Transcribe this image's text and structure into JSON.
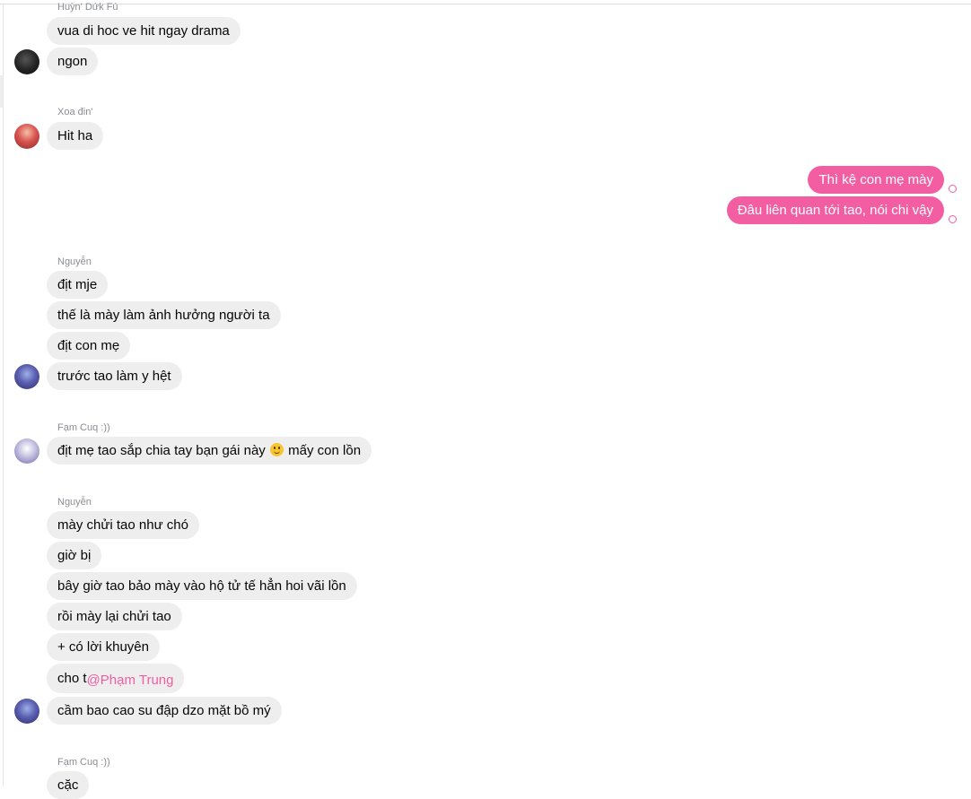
{
  "groups": [
    {
      "sender": "Huỳn' Dứk Fú",
      "messages": [
        "vua di hoc ve hit ngay drama",
        "ngon"
      ]
    },
    {
      "sender": "Xoa đin'",
      "messages": [
        "Hit ha"
      ]
    },
    {
      "sender": "",
      "messages": [
        "Thì kệ con mẹ mày",
        "Đâu liên quan tới tao, nói chi vậy"
      ]
    },
    {
      "sender": "Nguyễn",
      "messages": [
        "địt mje",
        "thế là mày làm ảnh hưởng người ta",
        "địt con mẹ",
        "trước tao làm y hệt"
      ]
    },
    {
      "sender": "Fạm Cuq :))",
      "messages": [
        "địt mẹ tao sắp chia tay bạn gái này",
        "mấy con lồn"
      ]
    },
    {
      "sender": "Nguyễn",
      "messages": [
        "mày chửi tao như chó",
        "giờ bị",
        "bây giờ tao bảo mày vào hộ tử tế hẳn hoi vãi lồn",
        "rồi mày lại chửi tao",
        "+ có lời khuyên",
        "cho t",
        "cầm bao cao su đập dzo mặt bồ mý"
      ],
      "mention": "@Phạm Trung"
    },
    {
      "sender": "Fạm Cuq :))",
      "messages": [
        "cặc"
      ]
    }
  ],
  "icons": {
    "emoji": "slightly-smiling-face-icon",
    "seen": "seen-check-icon"
  },
  "colors": {
    "outgoing_bubble": "#f35ea3",
    "incoming_bubble": "#eeeeee",
    "mention": "#f35ea3"
  }
}
